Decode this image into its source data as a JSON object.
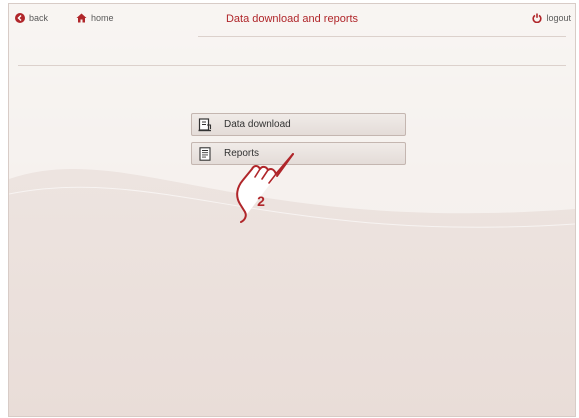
{
  "header": {
    "back_label": "back",
    "home_label": "home",
    "title": "Data download and reports",
    "logout_label": "logout"
  },
  "menu": {
    "items": [
      {
        "label": "Data download",
        "icon": "download-document-icon"
      },
      {
        "label": "Reports",
        "icon": "report-document-icon"
      }
    ]
  },
  "annotation": {
    "step_number": "2"
  },
  "colors": {
    "accent": "#b0262a",
    "text": "#333333",
    "background": "#efe7e3"
  }
}
